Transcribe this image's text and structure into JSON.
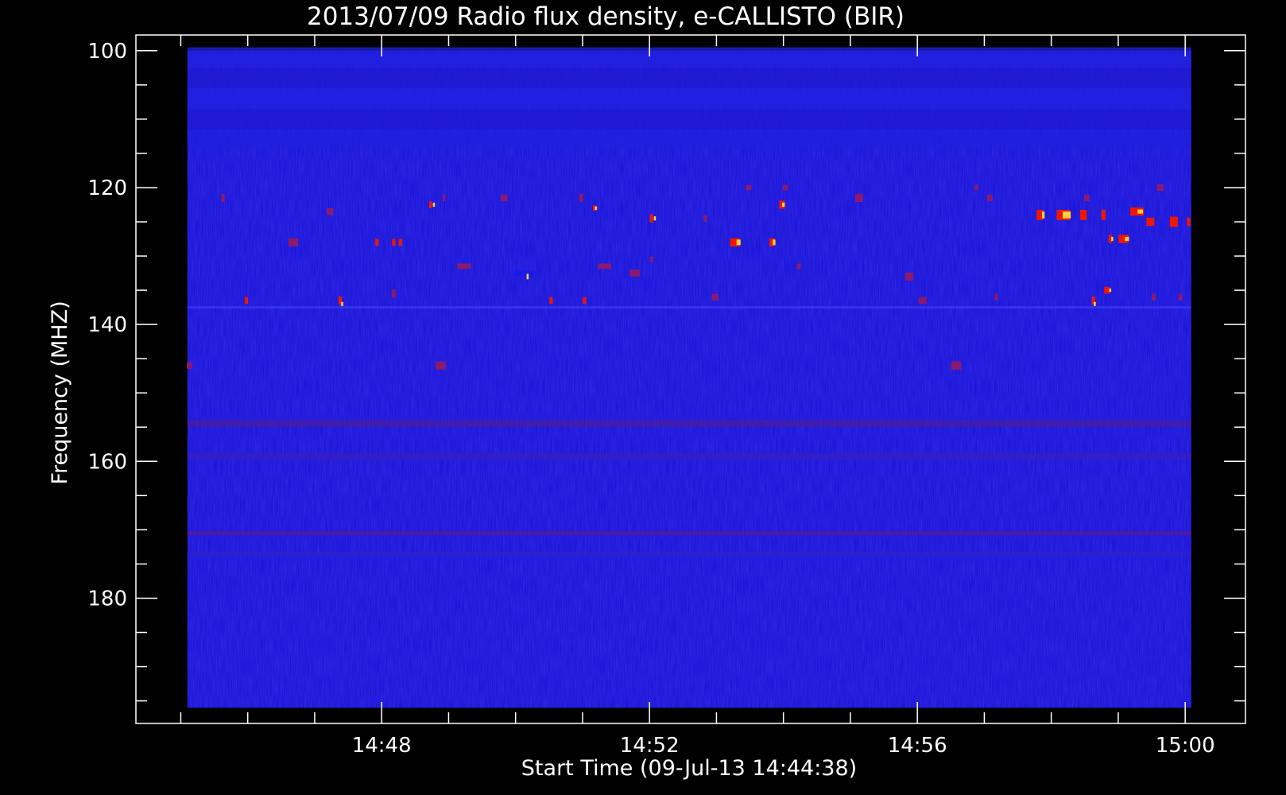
{
  "chart_data": {
    "type": "heatmap",
    "title": "2013/07/09  Radio flux density, e-CALLISTO (BIR)",
    "xlabel": "Start Time (09-Jul-13 14:44:38)",
    "ylabel": "Frequency (MHZ)",
    "y_axis_inverted": true,
    "ylim": [
      97.7,
      198.3
    ],
    "y_data_range": [
      100,
      196
    ],
    "y_major_ticks": [
      100,
      120,
      140,
      160,
      180
    ],
    "y_minor_ticks": [
      105,
      110,
      115,
      125,
      130,
      135,
      145,
      150,
      155,
      165,
      170,
      175,
      185,
      190,
      195
    ],
    "y_tick_labels": [
      "100",
      "120",
      "140",
      "160",
      "180"
    ],
    "x_range_minutes": [
      -0.3,
      16.27
    ],
    "x_data_range_minutes": [
      0.47,
      15.46
    ],
    "x_major_ticks_minutes": [
      3.37,
      7.37,
      11.37,
      15.37
    ],
    "x_tick_labels": [
      "14:48",
      "14:52",
      "14:56",
      "15:00"
    ],
    "x_minor_ticks_minutes": [
      0.37,
      1.37,
      2.37,
      4.37,
      5.37,
      6.37,
      8.37,
      9.37,
      10.37,
      12.37,
      13.37,
      14.37
    ],
    "colormap": {
      "background": "#1410d8",
      "low": "#1a1ae8",
      "mid": "#8a1a70",
      "high": "#ee1800",
      "peak": "#ffd040"
    },
    "noise_bands_mhz": [
      {
        "freq": 101,
        "width": 3,
        "color": "#2222dd"
      },
      {
        "freq": 104,
        "width": 3,
        "color": "#1e1ad0"
      },
      {
        "freq": 107,
        "width": 3,
        "color": "#2222e0"
      },
      {
        "freq": 110,
        "width": 3,
        "color": "#1d1ad4"
      },
      {
        "freq": 113,
        "width": 3,
        "color": "#2020dd"
      },
      {
        "freq": 154.5,
        "width": 1,
        "color": "#4a1ca0"
      },
      {
        "freq": 159.3,
        "width": 1,
        "color": "#3a1ec0"
      },
      {
        "freq": 170.5,
        "width": 0.6,
        "color": "#5a1a90"
      },
      {
        "freq": 173.5,
        "width": 0.6,
        "color": "#3020c8"
      },
      {
        "freq": 137.5,
        "width": 0.4,
        "color": "#3838f0"
      }
    ],
    "bursts": [
      {
        "t": 0.5,
        "f": 146,
        "dt": 0.08,
        "df": 1.0,
        "level": "mid"
      },
      {
        "t": 1.0,
        "f": 121.5,
        "dt": 0.05,
        "df": 1.2,
        "level": "mid"
      },
      {
        "t": 1.35,
        "f": 136.5,
        "dt": 0.05,
        "df": 1.0,
        "level": "high"
      },
      {
        "t": 2.05,
        "f": 128.0,
        "dt": 0.15,
        "df": 1.2,
        "level": "mid"
      },
      {
        "t": 2.6,
        "f": 123.5,
        "dt": 0.1,
        "df": 1.0,
        "level": "mid"
      },
      {
        "t": 2.75,
        "f": 136.5,
        "dt": 0.05,
        "df": 1.2,
        "level": "high"
      },
      {
        "t": 2.78,
        "f": 137.0,
        "dt": 0.03,
        "df": 0.6,
        "level": "peak"
      },
      {
        "t": 3.3,
        "f": 128.0,
        "dt": 0.05,
        "df": 1.0,
        "level": "high"
      },
      {
        "t": 3.55,
        "f": 128.0,
        "dt": 0.05,
        "df": 1.0,
        "level": "high"
      },
      {
        "t": 3.65,
        "f": 128.0,
        "dt": 0.05,
        "df": 1.0,
        "level": "high"
      },
      {
        "t": 3.55,
        "f": 135.5,
        "dt": 0.06,
        "df": 1.2,
        "level": "mid"
      },
      {
        "t": 4.1,
        "f": 122.5,
        "dt": 0.04,
        "df": 1.0,
        "level": "high"
      },
      {
        "t": 4.15,
        "f": 122.5,
        "dt": 0.03,
        "df": 0.6,
        "level": "peak"
      },
      {
        "t": 4.25,
        "f": 146.0,
        "dt": 0.15,
        "df": 1.2,
        "level": "mid"
      },
      {
        "t": 4.3,
        "f": 121.5,
        "dt": 0.04,
        "df": 1.0,
        "level": "mid"
      },
      {
        "t": 4.6,
        "f": 131.5,
        "dt": 0.2,
        "df": 0.8,
        "level": "mid"
      },
      {
        "t": 5.2,
        "f": 121.5,
        "dt": 0.1,
        "df": 1.0,
        "level": "mid"
      },
      {
        "t": 5.5,
        "f": 132.5,
        "dt": 0.3,
        "df": 0.8,
        "level": "low"
      },
      {
        "t": 5.55,
        "f": 133.0,
        "dt": 0.03,
        "df": 0.8,
        "level": "peak"
      },
      {
        "t": 5.9,
        "f": 136.5,
        "dt": 0.05,
        "df": 1.0,
        "level": "high"
      },
      {
        "t": 6.35,
        "f": 121.5,
        "dt": 0.06,
        "df": 1.2,
        "level": "mid"
      },
      {
        "t": 6.55,
        "f": 123.0,
        "dt": 0.05,
        "df": 0.8,
        "level": "high"
      },
      {
        "t": 6.57,
        "f": 123.0,
        "dt": 0.03,
        "df": 0.5,
        "level": "peak"
      },
      {
        "t": 6.4,
        "f": 136.5,
        "dt": 0.05,
        "df": 1.0,
        "level": "high"
      },
      {
        "t": 6.7,
        "f": 131.5,
        "dt": 0.2,
        "df": 0.8,
        "level": "mid"
      },
      {
        "t": 7.15,
        "f": 132.5,
        "dt": 0.15,
        "df": 1.0,
        "level": "mid"
      },
      {
        "t": 7.4,
        "f": 124.5,
        "dt": 0.05,
        "df": 1.2,
        "level": "high"
      },
      {
        "t": 7.45,
        "f": 124.5,
        "dt": 0.03,
        "df": 0.6,
        "level": "peak"
      },
      {
        "t": 7.4,
        "f": 130.5,
        "dt": 0.05,
        "df": 0.8,
        "level": "mid"
      },
      {
        "t": 8.2,
        "f": 124.5,
        "dt": 0.05,
        "df": 1.0,
        "level": "mid"
      },
      {
        "t": 8.35,
        "f": 136.0,
        "dt": 0.1,
        "df": 1.0,
        "level": "mid"
      },
      {
        "t": 8.65,
        "f": 128.0,
        "dt": 0.15,
        "df": 1.2,
        "level": "high"
      },
      {
        "t": 8.7,
        "f": 128.0,
        "dt": 0.06,
        "df": 0.8,
        "level": "peak"
      },
      {
        "t": 8.85,
        "f": 120.0,
        "dt": 0.08,
        "df": 0.8,
        "level": "mid"
      },
      {
        "t": 9.2,
        "f": 128.0,
        "dt": 0.08,
        "df": 1.2,
        "level": "high"
      },
      {
        "t": 9.23,
        "f": 128.0,
        "dt": 0.04,
        "df": 0.8,
        "level": "peak"
      },
      {
        "t": 9.35,
        "f": 122.5,
        "dt": 0.08,
        "df": 1.2,
        "level": "high"
      },
      {
        "t": 9.37,
        "f": 122.5,
        "dt": 0.04,
        "df": 0.6,
        "level": "peak"
      },
      {
        "t": 9.4,
        "f": 120.0,
        "dt": 0.08,
        "df": 0.8,
        "level": "mid"
      },
      {
        "t": 9.6,
        "f": 131.5,
        "dt": 0.06,
        "df": 0.8,
        "level": "mid"
      },
      {
        "t": 10.5,
        "f": 121.5,
        "dt": 0.12,
        "df": 1.2,
        "level": "mid"
      },
      {
        "t": 11.25,
        "f": 133.0,
        "dt": 0.12,
        "df": 1.2,
        "level": "mid"
      },
      {
        "t": 11.45,
        "f": 136.5,
        "dt": 0.12,
        "df": 1.0,
        "level": "mid"
      },
      {
        "t": 11.95,
        "f": 146.0,
        "dt": 0.15,
        "df": 1.2,
        "level": "mid"
      },
      {
        "t": 12.25,
        "f": 120.0,
        "dt": 0.05,
        "df": 0.8,
        "level": "mid"
      },
      {
        "t": 12.45,
        "f": 121.5,
        "dt": 0.08,
        "df": 1.0,
        "level": "mid"
      },
      {
        "t": 12.55,
        "f": 136.0,
        "dt": 0.05,
        "df": 1.0,
        "level": "mid"
      },
      {
        "t": 13.2,
        "f": 124.0,
        "dt": 0.1,
        "df": 1.5,
        "level": "high"
      },
      {
        "t": 13.25,
        "f": 124.0,
        "dt": 0.04,
        "df": 1.0,
        "level": "peak"
      },
      {
        "t": 13.55,
        "f": 124.0,
        "dt": 0.2,
        "df": 1.5,
        "level": "high"
      },
      {
        "t": 13.6,
        "f": 124.0,
        "dt": 0.12,
        "df": 1.0,
        "level": "peak"
      },
      {
        "t": 13.85,
        "f": 124.0,
        "dt": 0.1,
        "df": 1.5,
        "level": "high"
      },
      {
        "t": 13.9,
        "f": 121.5,
        "dt": 0.08,
        "df": 1.0,
        "level": "mid"
      },
      {
        "t": 14.15,
        "f": 124.0,
        "dt": 0.06,
        "df": 1.5,
        "level": "high"
      },
      {
        "t": 14.25,
        "f": 127.5,
        "dt": 0.05,
        "df": 1.2,
        "level": "high"
      },
      {
        "t": 14.28,
        "f": 127.5,
        "dt": 0.03,
        "df": 0.6,
        "level": "peak"
      },
      {
        "t": 14.45,
        "f": 127.5,
        "dt": 0.15,
        "df": 1.2,
        "level": "high"
      },
      {
        "t": 14.5,
        "f": 127.5,
        "dt": 0.06,
        "df": 0.6,
        "level": "peak"
      },
      {
        "t": 14.2,
        "f": 135.0,
        "dt": 0.08,
        "df": 1.0,
        "level": "high"
      },
      {
        "t": 14.25,
        "f": 135.0,
        "dt": 0.03,
        "df": 0.5,
        "level": "peak"
      },
      {
        "t": 14.0,
        "f": 136.5,
        "dt": 0.05,
        "df": 1.2,
        "level": "high"
      },
      {
        "t": 14.02,
        "f": 137.0,
        "dt": 0.03,
        "df": 0.6,
        "level": "peak"
      },
      {
        "t": 14.65,
        "f": 123.5,
        "dt": 0.2,
        "df": 1.2,
        "level": "high"
      },
      {
        "t": 14.7,
        "f": 123.5,
        "dt": 0.08,
        "df": 0.6,
        "level": "peak"
      },
      {
        "t": 14.85,
        "f": 125.0,
        "dt": 0.12,
        "df": 1.2,
        "level": "high"
      },
      {
        "t": 15.0,
        "f": 120.0,
        "dt": 0.1,
        "df": 1.0,
        "level": "mid"
      },
      {
        "t": 15.2,
        "f": 125.0,
        "dt": 0.12,
        "df": 1.5,
        "level": "high"
      },
      {
        "t": 15.42,
        "f": 125.0,
        "dt": 0.05,
        "df": 1.2,
        "level": "high"
      },
      {
        "t": 14.9,
        "f": 136.0,
        "dt": 0.06,
        "df": 1.0,
        "level": "mid"
      },
      {
        "t": 15.3,
        "f": 136.0,
        "dt": 0.06,
        "df": 1.0,
        "level": "mid"
      }
    ]
  }
}
